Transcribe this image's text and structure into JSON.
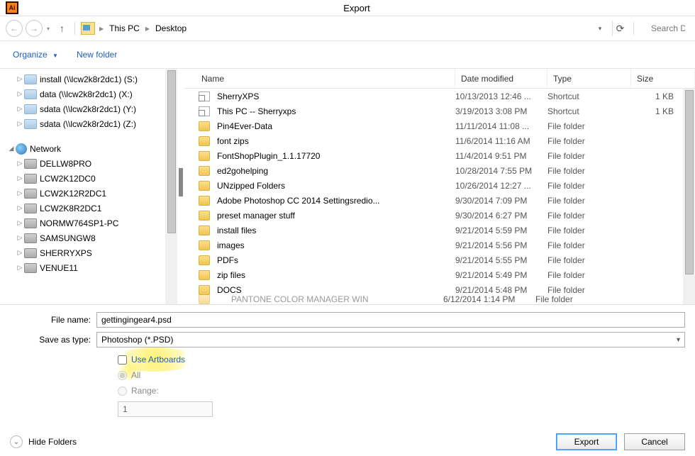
{
  "window": {
    "title": "Export",
    "app_icon_label": "Ai"
  },
  "nav": {
    "back": "←",
    "forward": "→",
    "up": "↑",
    "refresh": "⟳",
    "crumbs": [
      "This PC",
      "Desktop"
    ],
    "search_placeholder": "Search De"
  },
  "toolbar": {
    "organize": "Organize",
    "new_folder": "New folder"
  },
  "tree": {
    "drives": [
      "install (\\\\lcw2k8r2dc1) (S:)",
      "data (\\\\lcw2k8r2dc1) (X:)",
      "sdata (\\\\lcw2k8r2dc1) (Y:)",
      "sdata (\\\\lcw2k8r2dc1) (Z:)"
    ],
    "network_label": "Network",
    "network": [
      "DELLW8PRO",
      "LCW2K12DC0",
      "LCW2K12R2DC1",
      "LCW2K8R2DC1",
      "NORMW764SP1-PC",
      "SAMSUNGW8",
      "SHERRYXPS",
      "VENUE11"
    ]
  },
  "columns": {
    "name": "Name",
    "date": "Date modified",
    "type": "Type",
    "size": "Size"
  },
  "files": [
    {
      "name": "SherryXPS",
      "date": "10/13/2013 12:46 ...",
      "type": "Shortcut",
      "size": "1 KB",
      "icon": "shortcut"
    },
    {
      "name": "This PC -- Sherryxps",
      "date": "3/19/2013 3:08 PM",
      "type": "Shortcut",
      "size": "1 KB",
      "icon": "shortcut"
    },
    {
      "name": "Pin4Ever-Data",
      "date": "11/11/2014 11:08 ...",
      "type": "File folder",
      "size": "",
      "icon": "folder"
    },
    {
      "name": "font zips",
      "date": "11/6/2014 11:16 AM",
      "type": "File folder",
      "size": "",
      "icon": "folder"
    },
    {
      "name": "FontShopPlugin_1.1.17720",
      "date": "11/4/2014 9:51 PM",
      "type": "File folder",
      "size": "",
      "icon": "folder"
    },
    {
      "name": "ed2gohelping",
      "date": "10/28/2014 7:55 PM",
      "type": "File folder",
      "size": "",
      "icon": "folder"
    },
    {
      "name": "UNzipped Folders",
      "date": "10/26/2014 12:27 ...",
      "type": "File folder",
      "size": "",
      "icon": "folder"
    },
    {
      "name": "Adobe Photoshop CC 2014 Settingsredio...",
      "date": "9/30/2014 7:09 PM",
      "type": "File folder",
      "size": "",
      "icon": "folder"
    },
    {
      "name": "preset manager stuff",
      "date": "9/30/2014 6:27 PM",
      "type": "File folder",
      "size": "",
      "icon": "folder"
    },
    {
      "name": "install files",
      "date": "9/21/2014 5:59 PM",
      "type": "File folder",
      "size": "",
      "icon": "folder"
    },
    {
      "name": "images",
      "date": "9/21/2014 5:56 PM",
      "type": "File folder",
      "size": "",
      "icon": "folder"
    },
    {
      "name": "PDFs",
      "date": "9/21/2014 5:55 PM",
      "type": "File folder",
      "size": "",
      "icon": "folder"
    },
    {
      "name": "zip files",
      "date": "9/21/2014 5:49 PM",
      "type": "File folder",
      "size": "",
      "icon": "folder"
    },
    {
      "name": "DOCS",
      "date": "9/21/2014 5:48 PM",
      "type": "File folder",
      "size": "",
      "icon": "folder"
    }
  ],
  "files_cut": {
    "name": "PANTONE  COLOR  MANAGER  WIN",
    "date": "6/12/2014 1:14 PM",
    "type": "File folder"
  },
  "form": {
    "filename_label": "File name:",
    "filename_value": "gettingingear4.psd",
    "saveas_label": "Save as type:",
    "saveas_value": "Photoshop (*.PSD)",
    "use_artboards": "Use Artboards",
    "all": "All",
    "range": "Range:",
    "range_value": "1"
  },
  "footer": {
    "hide_folders": "Hide Folders",
    "export": "Export",
    "cancel": "Cancel"
  }
}
